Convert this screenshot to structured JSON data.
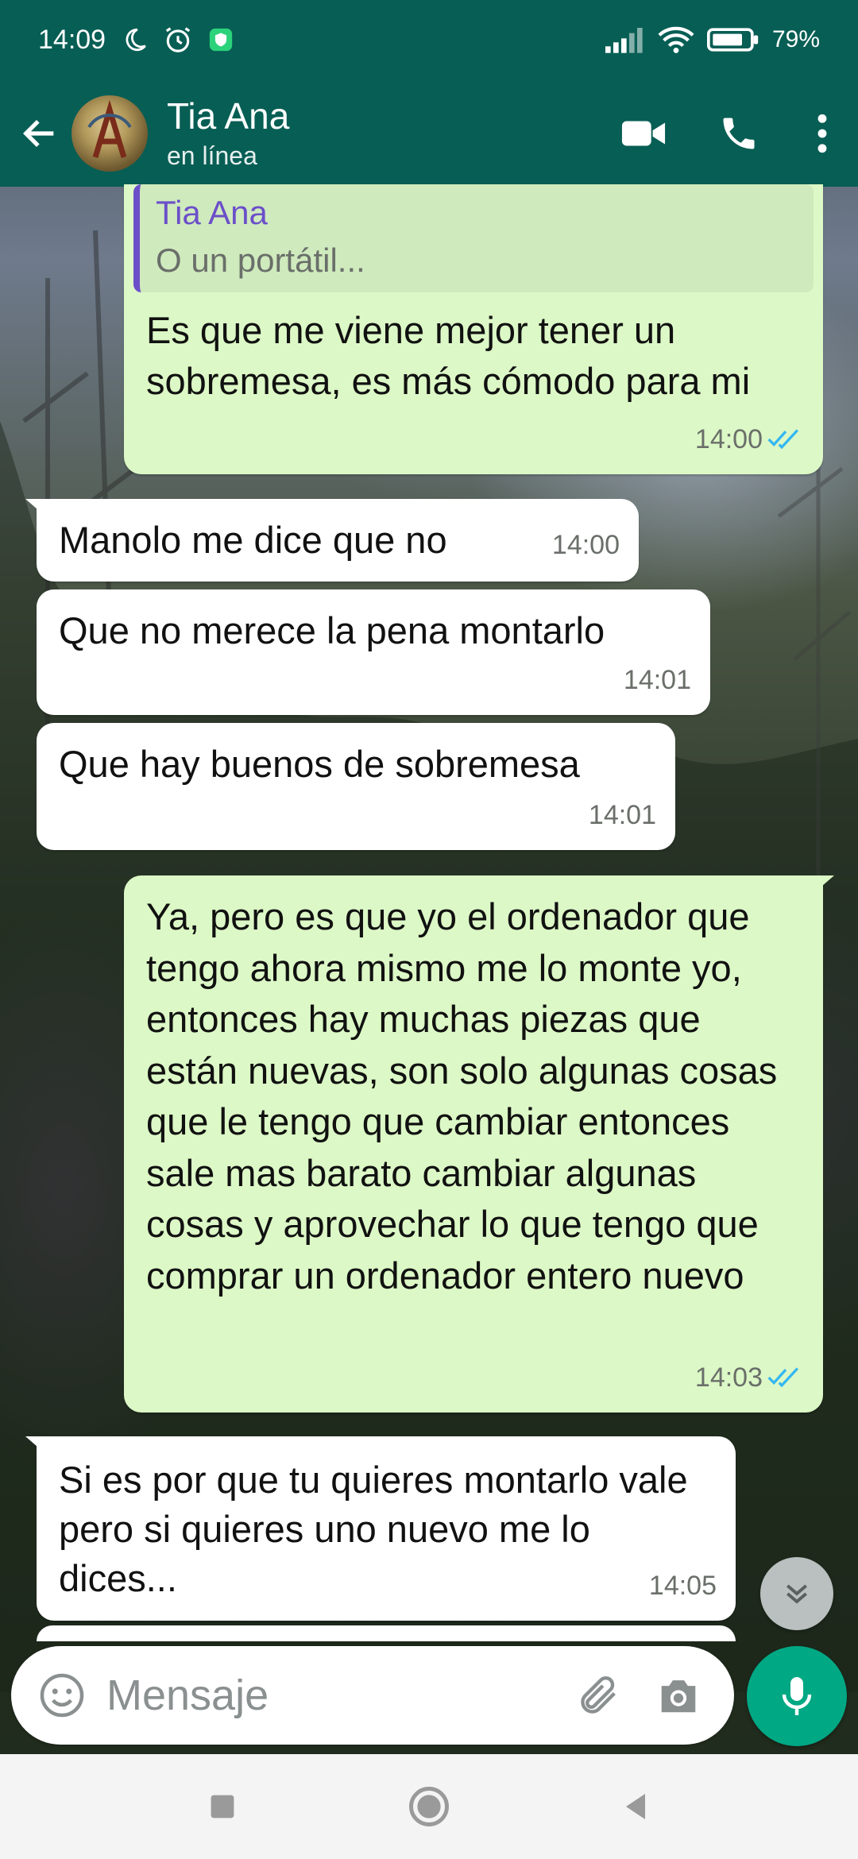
{
  "status_bar": {
    "time": "14:09",
    "battery": "79%"
  },
  "header": {
    "contact_name": "Tia Ana",
    "contact_status": "en línea"
  },
  "messages": [
    {
      "direction": "out",
      "quote": {
        "name": "Tia Ana",
        "text": "O un portátil..."
      },
      "text": "Es que me viene mejor tener un sobremesa, es más cómodo para mi",
      "time": "14:00",
      "read": true
    },
    {
      "direction": "in",
      "text": "Manolo me dice que no",
      "time": "14:00"
    },
    {
      "direction": "in",
      "text": "Que no merece la pena montarlo",
      "time": "14:01"
    },
    {
      "direction": "in",
      "text": "Que hay buenos de sobremesa",
      "time": "14:01"
    },
    {
      "direction": "out",
      "text": "Ya, pero es que yo el ordenador que tengo ahora mismo me lo monte yo, entonces hay muchas piezas que están nuevas, son solo algunas cosas que le tengo que cambiar entonces sale mas barato cambiar algunas cosas y aprovechar lo que tengo que comprar un ordenador entero nuevo",
      "time": "14:03",
      "read": true
    },
    {
      "direction": "in",
      "text": "Si es por que tu quieres montarlo vale pero si quieres uno nuevo me lo dices...",
      "time": "14:05"
    }
  ],
  "composer": {
    "placeholder": "Mensaje"
  },
  "colors": {
    "header": "#075e54",
    "outgoing_bubble": "#dcf8c6",
    "incoming_bubble": "#ffffff",
    "read_ticks": "#34b7f1",
    "mic_button": "#00a884"
  }
}
